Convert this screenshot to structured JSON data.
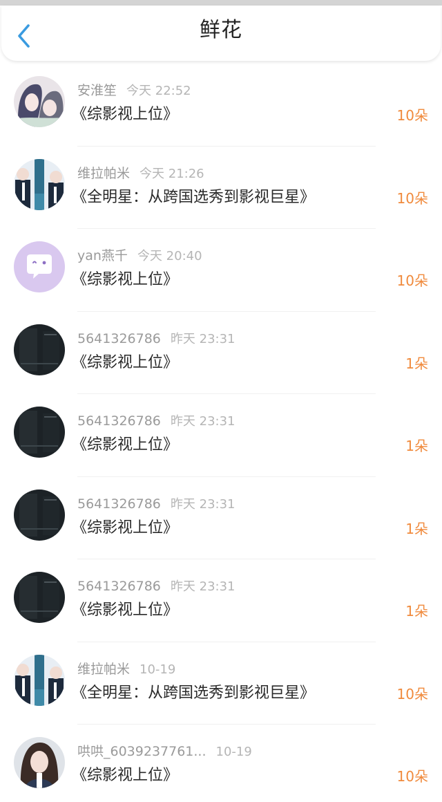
{
  "header": {
    "title": "鲜花"
  },
  "rows": [
    {
      "name": "安淮笙",
      "time": "今天 22:52",
      "book": "《综影视上位》",
      "count": "10朵",
      "avatar": "anime-couple"
    },
    {
      "name": "维拉帕米",
      "time": "今天 21:26",
      "book": "《全明星：从跨国选秀到影视巨星》",
      "count": "10朵",
      "avatar": "idol-group"
    },
    {
      "name": "yan燕千",
      "time": "今天 20:40",
      "book": "《综影视上位》",
      "count": "10朵",
      "avatar": "chat-bubble"
    },
    {
      "name": "5641326786",
      "time": "昨天 23:31",
      "book": "《综影视上位》",
      "count": "1朵",
      "avatar": "dark-photo"
    },
    {
      "name": "5641326786",
      "time": "昨天 23:31",
      "book": "《综影视上位》",
      "count": "1朵",
      "avatar": "dark-photo"
    },
    {
      "name": "5641326786",
      "time": "昨天 23:31",
      "book": "《综影视上位》",
      "count": "1朵",
      "avatar": "dark-photo"
    },
    {
      "name": "5641326786",
      "time": "昨天 23:31",
      "book": "《综影视上位》",
      "count": "1朵",
      "avatar": "dark-photo"
    },
    {
      "name": "维拉帕米",
      "time": "10-19",
      "book": "《全明星：从跨国选秀到影视巨星》",
      "count": "10朵",
      "avatar": "idol-group"
    },
    {
      "name": "哄哄_6039237761...",
      "time": "10-19",
      "book": "《综影视上位》",
      "count": "10朵",
      "avatar": "girl-portrait"
    }
  ],
  "colors": {
    "accent_back": "#3a9be0",
    "flower_count": "#f08a3c",
    "avatar_purple": "#d9c8ef"
  }
}
